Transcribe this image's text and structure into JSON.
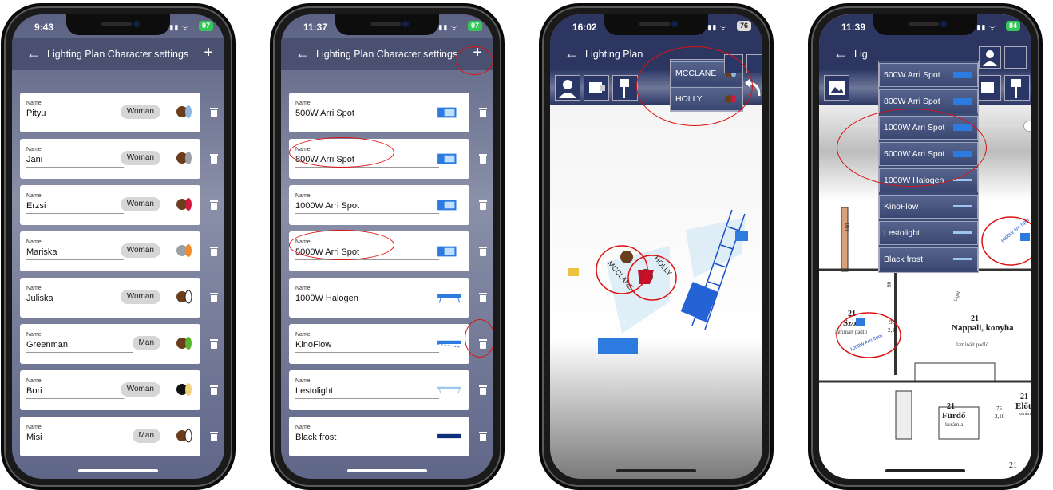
{
  "screens": [
    {
      "time": "9:43",
      "battery": "97",
      "title": "Lighting Plan Character settings",
      "characters": [
        {
          "label": "Name",
          "name": "Pityu",
          "gender": "Woman",
          "color": "#6a3e1c",
          "accent": "#8fb7e0"
        },
        {
          "label": "Name",
          "name": "Jani",
          "gender": "Woman",
          "color": "#6a3e1c",
          "accent": "#9aa0a6"
        },
        {
          "label": "Name",
          "name": "Erzsi",
          "gender": "Woman",
          "color": "#6a3e1c",
          "accent": "#d1193e"
        },
        {
          "label": "Name",
          "name": "Mariska",
          "gender": "Woman",
          "color": "#9aa0a6",
          "accent": "#f08a2c"
        },
        {
          "label": "Name",
          "name": "Juliska",
          "gender": "Woman",
          "color": "#6a3e1c",
          "accent": "#ffffff"
        },
        {
          "label": "Name",
          "name": "Greenman",
          "gender": "Man",
          "color": "#6a3e1c",
          "accent": "#58b52e"
        },
        {
          "label": "Name",
          "name": "Bori",
          "gender": "Woman",
          "color": "#111111",
          "accent": "#f0d27a"
        },
        {
          "label": "Name",
          "name": "Misi",
          "gender": "Man",
          "color": "#6a3e1c",
          "accent": "#ffffff"
        }
      ]
    },
    {
      "time": "11:37",
      "battery": "97",
      "title": "Lighting Plan Character settings",
      "lights": [
        {
          "label": "Name",
          "name": "500W Arri Spot"
        },
        {
          "label": "Name",
          "name": "800W Arri Spot"
        },
        {
          "label": "Name",
          "name": "1000W Arri Spot"
        },
        {
          "label": "Name",
          "name": "5000W Arri Spot"
        },
        {
          "label": "Name",
          "name": "1000W Halogen"
        },
        {
          "label": "Name",
          "name": "KinoFlow"
        },
        {
          "label": "Name",
          "name": "Lestolight"
        },
        {
          "label": "Name",
          "name": "Black frost"
        }
      ]
    },
    {
      "time": "16:02",
      "battery": "76",
      "title": "Lighting Plan",
      "popup": [
        {
          "name": "MCCLANE"
        },
        {
          "name": "HOLLY"
        }
      ],
      "canvas_labels": [
        "MCCLANE",
        "HOLLY"
      ]
    },
    {
      "time": "11:39",
      "battery": "84",
      "title": "Lig",
      "lamp_menu": [
        "500W Arri Spot",
        "800W Arri Spot",
        "1000W Arri Spot",
        "5000W Arri Spot",
        "1000W Halogen",
        "KinoFlow",
        "Lestolight",
        "Black frost"
      ],
      "plan_labels": {
        "room1_num": "21",
        "room1_name": "Szoba",
        "room1_sub": "laminált padló",
        "room2_num": "21",
        "room2_name": "Nappali, konyha",
        "room2_sub": "laminált padló",
        "room3_num": "21",
        "room3_name": "Fürdő",
        "room3_sub": "kerámia",
        "room4_num": "21",
        "room4_name": "Előt",
        "room4_sub": "kerám",
        "dim1": "90",
        "dim2": "2,10",
        "dim3": "75",
        "dim4": "2,10",
        "dim5": "180",
        "dim6": "90",
        "light_a": "8000W Arri Spot",
        "light_b": "1000W Arri Spot",
        "light_c": "Light",
        "bottom_num": "21"
      }
    }
  ]
}
